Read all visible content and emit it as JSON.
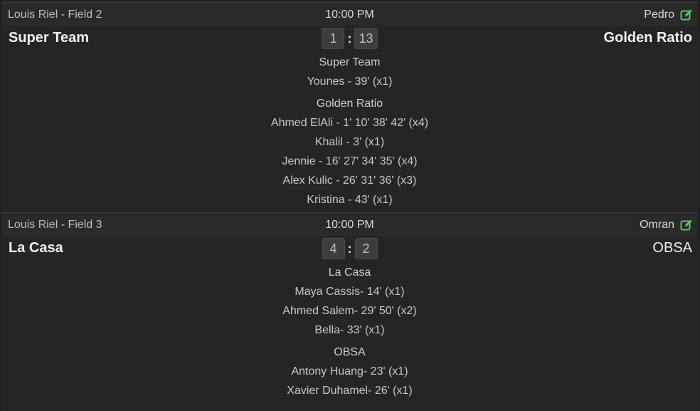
{
  "games": [
    {
      "field": "Louis Riel - Field 2",
      "time": "10:00 PM",
      "referee": "Pedro",
      "home_team": "Super Team",
      "away_team": "Golden Ratio",
      "home_score": "1",
      "away_score": "13",
      "score_separator": ":",
      "home_scorers_title": "Super Team",
      "home_scorers": [
        "Younes - 39' (x1)"
      ],
      "away_scorers_title": "Golden Ratio",
      "away_scorers": [
        "Ahmed ElAli - 1' 10' 38' 42' (x4)",
        "Khalil - 3' (x1)",
        "Jennie - 16' 27' 34' 35' (x4)",
        "Alex Kulic - 26' 31' 36' (x3)",
        "Kristina - 43' (x1)"
      ]
    },
    {
      "field": "Louis Riel - Field 3",
      "time": "10:00 PM",
      "referee": "Omran",
      "home_team": "La Casa",
      "away_team": "OBSA",
      "home_score": "4",
      "away_score": "2",
      "score_separator": ":",
      "home_scorers_title": "La Casa",
      "home_scorers": [
        "Maya Cassis- 14' (x1)",
        "Ahmed Salem- 29' 50' (x2)",
        "Bella- 33' (x1)"
      ],
      "away_scorers_title": "OBSA",
      "away_scorers": [
        "Antony Huang- 23' (x1)",
        "Xavier Duhamel- 26' (x1)"
      ]
    }
  ],
  "icons": {
    "edit": "edit-icon"
  },
  "colors": {
    "edit_icon": "#5cc85c",
    "background": "#222222",
    "score_box": "#3d3d3d"
  }
}
